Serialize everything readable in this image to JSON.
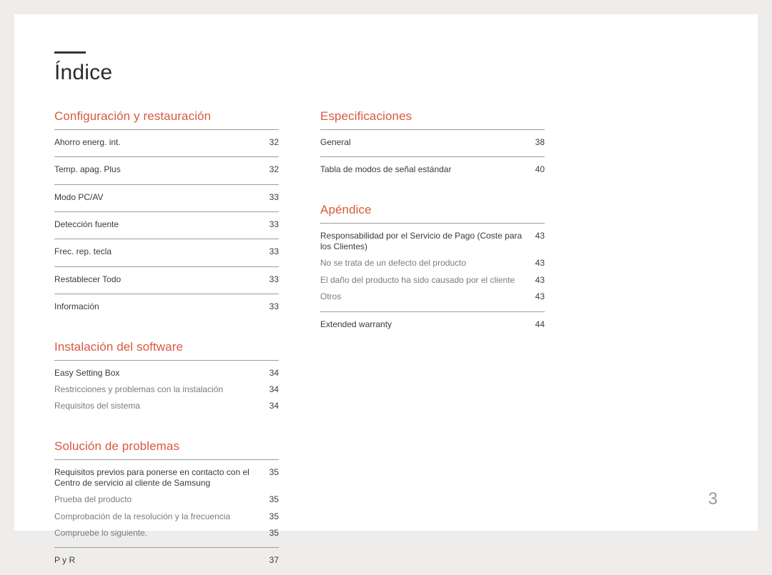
{
  "title": "Índice",
  "page_number": "3",
  "left": {
    "s1": {
      "title": "Configuración y restauración",
      "items": [
        {
          "label": "Ahorro energ. int.",
          "pg": "32"
        },
        {
          "label": "Temp. apag. Plus",
          "pg": "32"
        },
        {
          "label": "Modo PC/AV",
          "pg": "33"
        },
        {
          "label": "Detección fuente",
          "pg": "33"
        },
        {
          "label": "Frec. rep. tecla",
          "pg": "33"
        },
        {
          "label": "Restablecer Todo",
          "pg": "33"
        },
        {
          "label": "Información",
          "pg": "33"
        }
      ]
    },
    "s2": {
      "title": "Instalación del software",
      "g1": [
        {
          "label": "Easy Setting Box",
          "pg": "34",
          "sub": false
        },
        {
          "label": "Restricciones y problemas con la instalación",
          "pg": "34",
          "sub": true
        },
        {
          "label": "Requisitos del sistema",
          "pg": "34",
          "sub": true
        }
      ]
    },
    "s3": {
      "title": "Solución de problemas",
      "g1": [
        {
          "label": "Requisitos previos para ponerse en contacto con el Centro de servicio al cliente de Samsung",
          "pg": "35",
          "sub": false
        },
        {
          "label": "Prueba del producto",
          "pg": "35",
          "sub": true
        },
        {
          "label": "Comprobación de la resolución y la frecuencia",
          "pg": "35",
          "sub": true
        },
        {
          "label": "Compruebe lo siguiente.",
          "pg": "35",
          "sub": true
        }
      ],
      "g2": [
        {
          "label": "P y R",
          "pg": "37",
          "sub": false
        }
      ]
    }
  },
  "right": {
    "s1": {
      "title": "Especificaciones",
      "items": [
        {
          "label": "General",
          "pg": "38"
        },
        {
          "label": "Tabla de modos de señal estándar",
          "pg": "40"
        }
      ]
    },
    "s2": {
      "title": "Apéndice",
      "g1": [
        {
          "label": "Responsabilidad por el Servicio de Pago (Coste para los Clientes)",
          "pg": "43",
          "sub": false
        },
        {
          "label": "No se trata de un defecto del producto",
          "pg": "43",
          "sub": true
        },
        {
          "label": "El daño del producto ha sido causado por el cliente",
          "pg": "43",
          "sub": true
        },
        {
          "label": "Otros",
          "pg": "43",
          "sub": true
        }
      ],
      "g2": [
        {
          "label": "Extended warranty",
          "pg": "44",
          "sub": false
        }
      ]
    }
  }
}
